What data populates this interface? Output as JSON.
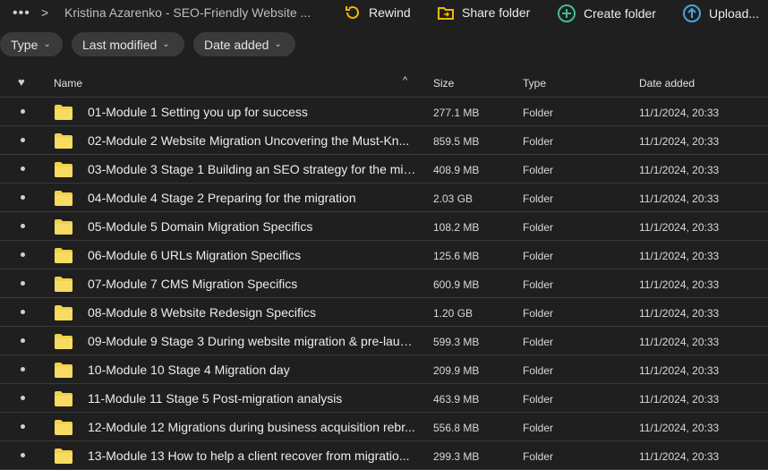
{
  "topbar": {
    "more_icon": "more-dots-icon",
    "breadcrumb": "Kristina Azarenko - SEO-Friendly Website ...",
    "rewind_label": "Rewind",
    "share_label": "Share folder",
    "create_label": "Create folder",
    "upload_label": "Upload...",
    "colors": {
      "rewind": "#f2b705",
      "share": "#f2b705",
      "create": "#3fbf8f",
      "upload": "#4aa3df"
    }
  },
  "filters": {
    "type_label": "Type",
    "modified_label": "Last modified",
    "added_label": "Date added"
  },
  "table": {
    "columns": {
      "name": "Name",
      "size": "Size",
      "type": "Type",
      "date": "Date added"
    },
    "rows": [
      {
        "name": "01-Module 1 Setting you up for success",
        "size": "277.1 MB",
        "type": "Folder",
        "date": "11/1/2024, 20:33"
      },
      {
        "name": "02-Module 2 Website Migration Uncovering the Must-Kn...",
        "size": "859.5 MB",
        "type": "Folder",
        "date": "11/1/2024, 20:33"
      },
      {
        "name": "03-Module 3 Stage 1 Building an SEO strategy for the mig...",
        "size": "408.9 MB",
        "type": "Folder",
        "date": "11/1/2024, 20:33"
      },
      {
        "name": "04-Module 4 Stage 2 Preparing for the migration",
        "size": "2.03 GB",
        "type": "Folder",
        "date": "11/1/2024, 20:33"
      },
      {
        "name": "05-Module 5 Domain Migration Specifics",
        "size": "108.2 MB",
        "type": "Folder",
        "date": "11/1/2024, 20:33"
      },
      {
        "name": "06-Module 6 URLs Migration Specifics",
        "size": "125.6 MB",
        "type": "Folder",
        "date": "11/1/2024, 20:33"
      },
      {
        "name": "07-Module 7 CMS Migration Specifics",
        "size": "600.9 MB",
        "type": "Folder",
        "date": "11/1/2024, 20:33"
      },
      {
        "name": "08-Module 8 Website Redesign Specifics",
        "size": "1.20 GB",
        "type": "Folder",
        "date": "11/1/2024, 20:33"
      },
      {
        "name": "09-Module 9 Stage 3 During website migration & pre-laun...",
        "size": "599.3 MB",
        "type": "Folder",
        "date": "11/1/2024, 20:33"
      },
      {
        "name": "10-Module 10 Stage 4 Migration day",
        "size": "209.9 MB",
        "type": "Folder",
        "date": "11/1/2024, 20:33"
      },
      {
        "name": "11-Module 11 Stage 5 Post-migration analysis",
        "size": "463.9 MB",
        "type": "Folder",
        "date": "11/1/2024, 20:33"
      },
      {
        "name": "12-Module 12 Migrations during business acquisition rebr...",
        "size": "556.8 MB",
        "type": "Folder",
        "date": "11/1/2024, 20:33"
      },
      {
        "name": "13-Module 13 How to help a client recover from migratio...",
        "size": "299.3 MB",
        "type": "Folder",
        "date": "11/1/2024, 20:33"
      }
    ]
  }
}
